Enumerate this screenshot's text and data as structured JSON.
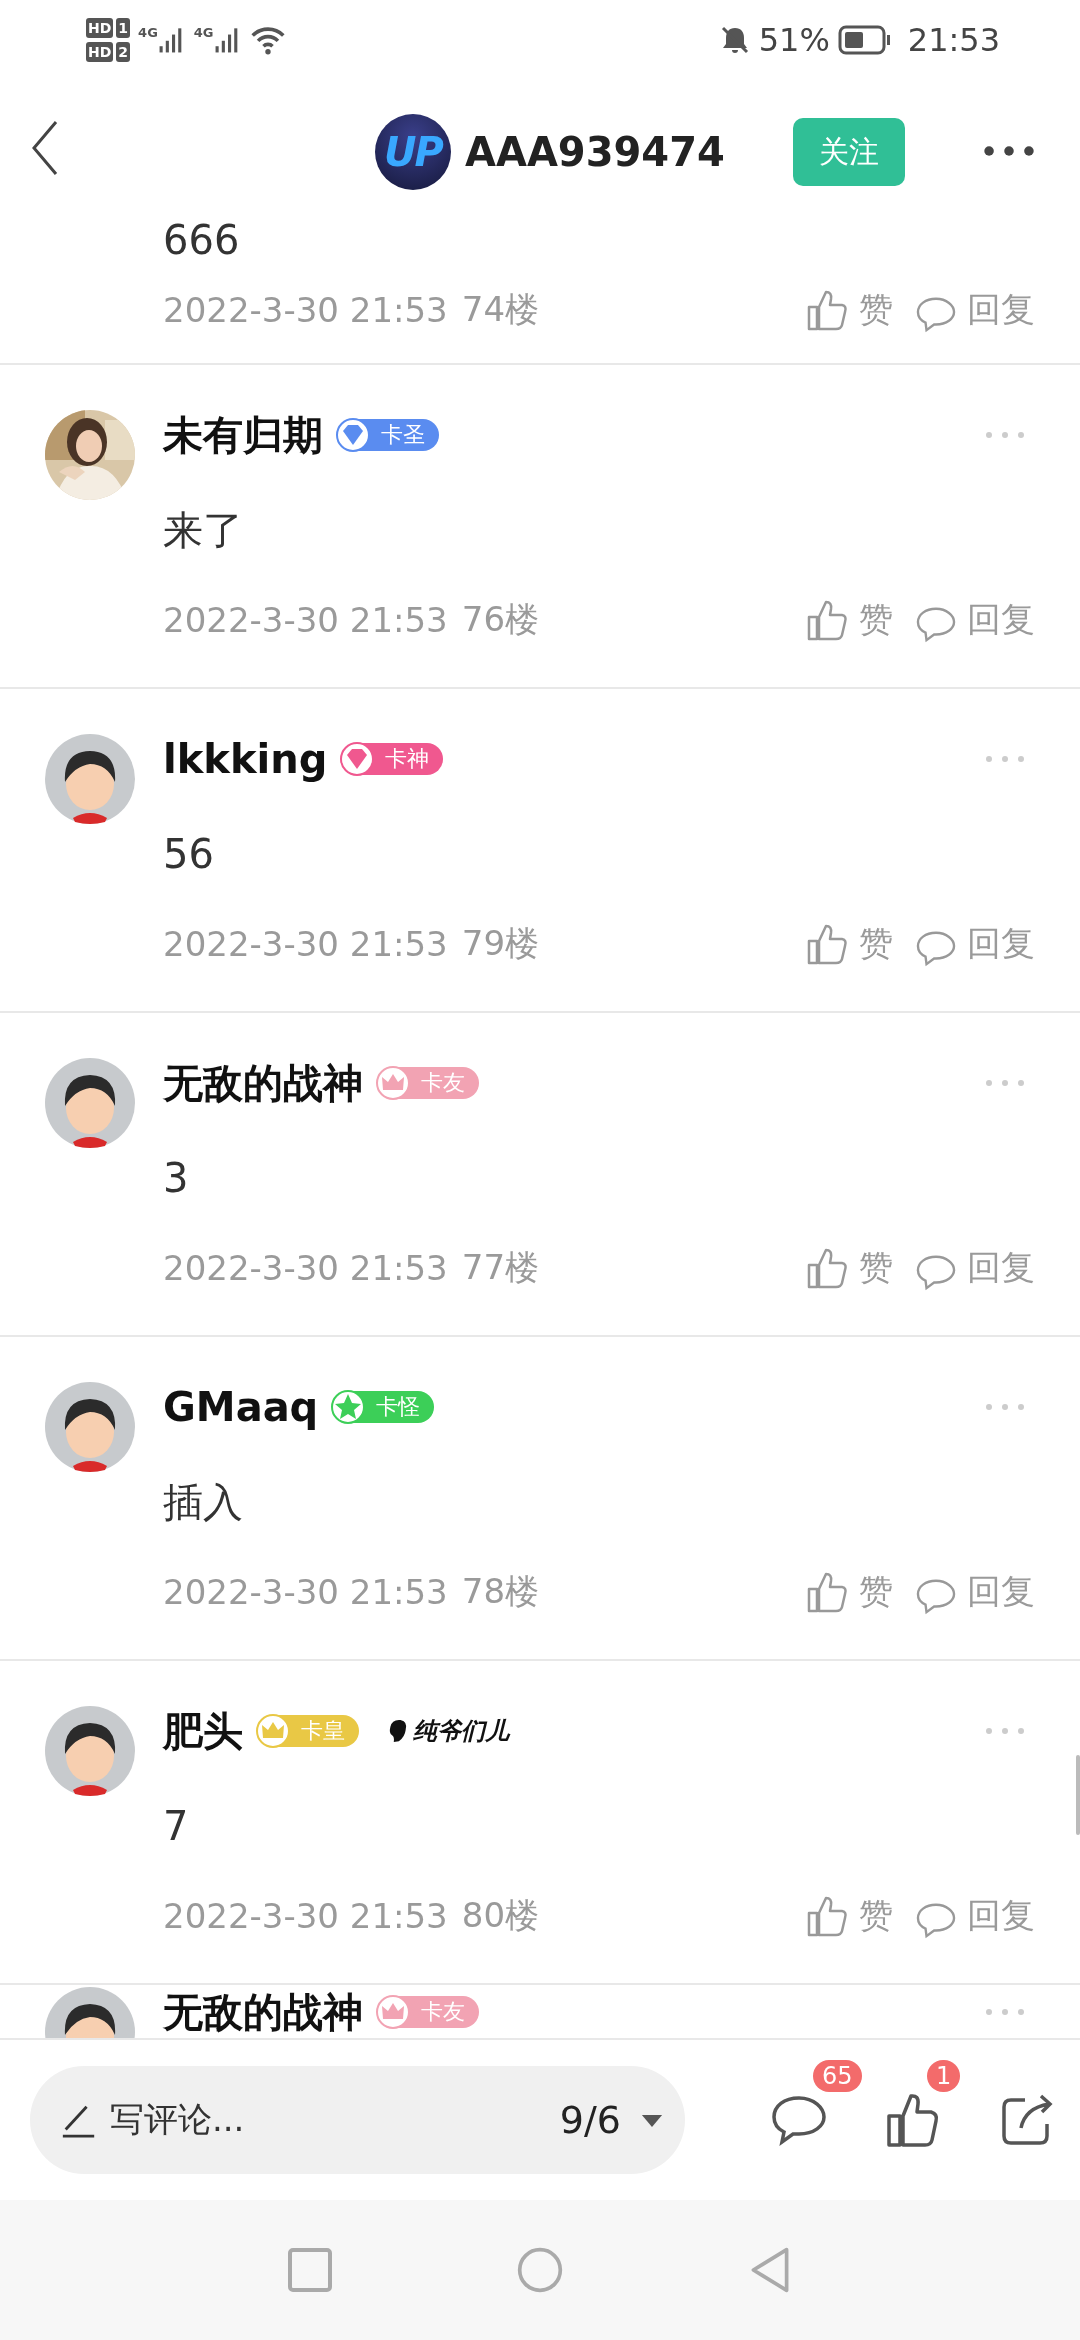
{
  "status_bar": {
    "sims": [
      {
        "label": "HD",
        "slot": "1"
      },
      {
        "label": "HD",
        "slot": "2"
      }
    ],
    "networks": [
      "4G",
      "4G"
    ],
    "battery": "51%",
    "time": "21:53"
  },
  "header": {
    "avatar_text": "UP",
    "title": "AAA939474",
    "follow": "关注"
  },
  "comments": [
    {
      "content": "666",
      "date": "2022-3-30 21:53",
      "floor": "74楼",
      "like": "赞",
      "reply": "回复"
    },
    {
      "name": "未有归期",
      "badge": {
        "kind": "diamond",
        "label": "卡圣",
        "color": "#5a8cf0"
      },
      "content": "来了",
      "date": "2022-3-30 21:53",
      "floor": "76楼",
      "like": "赞",
      "reply": "回复"
    },
    {
      "avatar": {
        "kind": "cartoon"
      },
      "name": "lkkking",
      "badge": {
        "kind": "diamond",
        "label": "卡神",
        "color": "#f0588f"
      },
      "content": "56",
      "date": "2022-3-30 21:53",
      "floor": "79楼",
      "like": "赞",
      "reply": "回复"
    },
    {
      "avatar": {
        "kind": "cartoon"
      },
      "name": "无敌的战神",
      "badge": {
        "kind": "crown",
        "label": "卡友",
        "color": "#f2a3b3"
      },
      "content": "3",
      "date": "2022-3-30 21:53",
      "floor": "77楼",
      "like": "赞",
      "reply": "回复"
    },
    {
      "avatar": {
        "kind": "cartoon"
      },
      "name": "GMaaq",
      "badge": {
        "kind": "star",
        "label": "卡怪",
        "color": "#3ccf58"
      },
      "content": "插入",
      "date": "2022-3-30 21:53",
      "floor": "78楼",
      "like": "赞",
      "reply": "回复"
    },
    {
      "avatar": {
        "kind": "cartoon"
      },
      "name": "肥头",
      "badge": {
        "kind": "crown",
        "label": "卡皇",
        "color": "#e9c845"
      },
      "tag": "纯爷们儿",
      "content": "7",
      "date": "2022-3-30 21:53",
      "floor": "80楼",
      "like": "赞",
      "reply": "回复"
    },
    {
      "avatar": {
        "kind": "cartoon"
      },
      "name": "无敌的战神",
      "badge": {
        "kind": "crown",
        "label": "卡友",
        "color": "#f2a3b3"
      }
    }
  ],
  "bottom_bar": {
    "placeholder": "写评论...",
    "page": "9/6",
    "comment_count": "65",
    "like_count": "1"
  }
}
